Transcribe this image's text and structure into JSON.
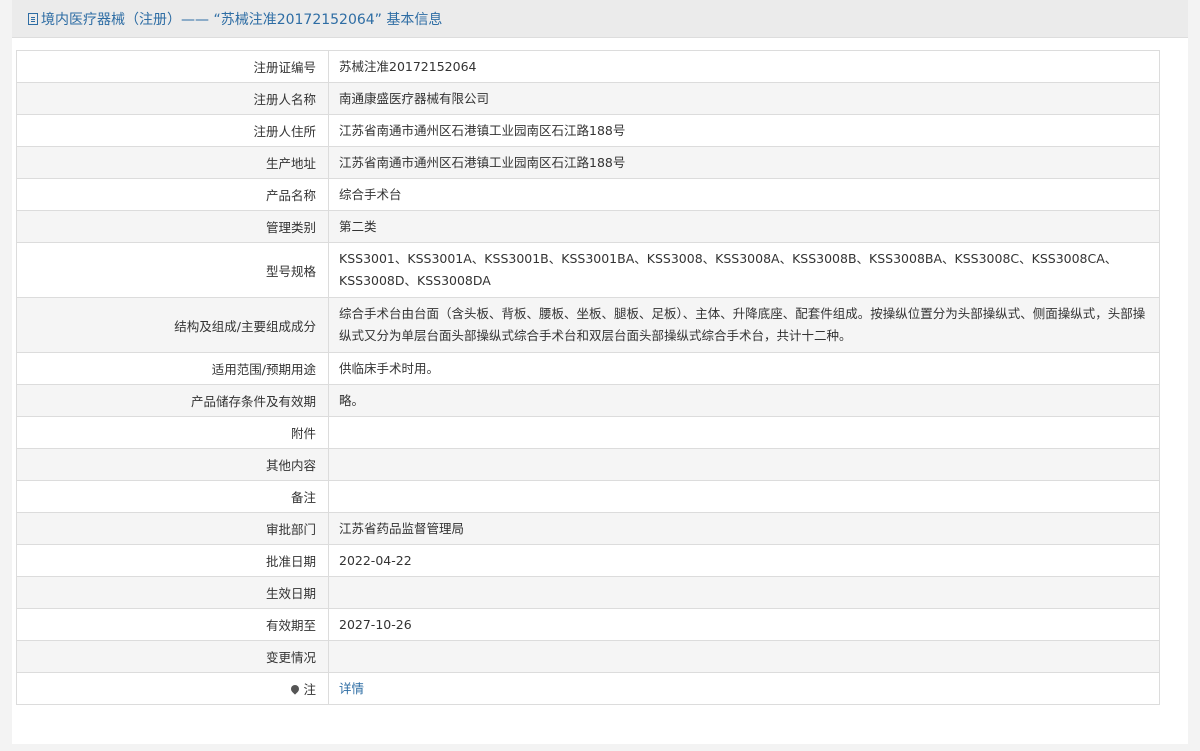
{
  "header": {
    "title": "境内医疗器械（注册）——  “苏械注准20172152064” 基本信息"
  },
  "rows": [
    {
      "label": "注册证编号",
      "value": "苏械注准20172152064"
    },
    {
      "label": "注册人名称",
      "value": "南通康盛医疗器械有限公司"
    },
    {
      "label": "注册人住所",
      "value": "江苏省南通市通州区石港镇工业园南区石江路188号"
    },
    {
      "label": "生产地址",
      "value": "江苏省南通市通州区石港镇工业园南区石江路188号"
    },
    {
      "label": "产品名称",
      "value": "综合手术台"
    },
    {
      "label": "管理类别",
      "value": "第二类"
    },
    {
      "label": "型号规格",
      "value": "KSS3001、KSS3001A、KSS3001B、KSS3001BA、KSS3008、KSS3008A、KSS3008B、KSS3008BA、KSS3008C、KSS3008CA、KSS3008D、KSS3008DA"
    },
    {
      "label": "结构及组成/主要组成成分",
      "value": "综合手术台由台面（含头板、背板、腰板、坐板、腿板、足板）、主体、升降底座、配套件组成。按操纵位置分为头部操纵式、侧面操纵式，头部操纵式又分为单层台面头部操纵式综合手术台和双层台面头部操纵式综合手术台，共计十二种。"
    },
    {
      "label": "适用范围/预期用途",
      "value": "供临床手术时用。"
    },
    {
      "label": "产品储存条件及有效期",
      "value": "略。"
    },
    {
      "label": "附件",
      "value": ""
    },
    {
      "label": "其他内容",
      "value": ""
    },
    {
      "label": "备注",
      "value": ""
    },
    {
      "label": "审批部门",
      "value": "江苏省药品监督管理局"
    },
    {
      "label": "批准日期",
      "value": "2022-04-22"
    },
    {
      "label": "生效日期",
      "value": ""
    },
    {
      "label": "有效期至",
      "value": "2027-10-26"
    },
    {
      "label": "变更情况",
      "value": ""
    },
    {
      "label": "注",
      "value": "详情"
    }
  ],
  "icons": {
    "title_icon": "document-icon",
    "note_icon": "pin-icon"
  },
  "colors": {
    "link": "#2e6da4",
    "header_bg": "#ebebeb"
  }
}
